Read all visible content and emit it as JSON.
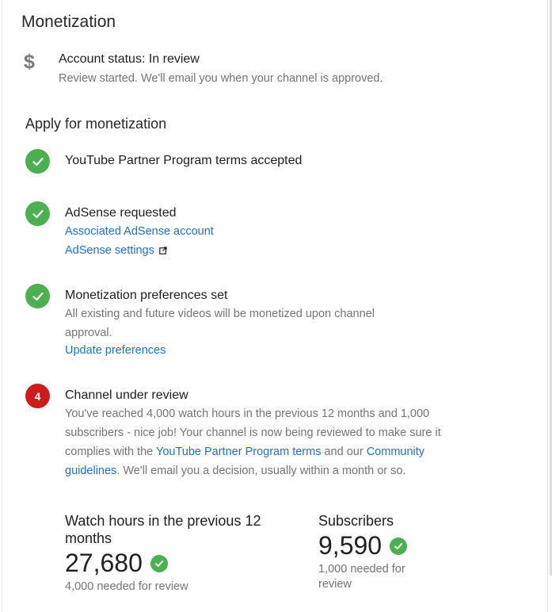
{
  "header": {
    "title": "Monetization"
  },
  "account_status": {
    "icon": "dollar-icon",
    "heading": "Account status: In review",
    "subtext": "Review started. We'll email you when your channel is approved."
  },
  "apply": {
    "heading": "Apply for monetization",
    "steps": [
      {
        "title": "YouTube Partner Program terms accepted"
      },
      {
        "title": "AdSense requested",
        "link1": "Associated AdSense account",
        "link2": "AdSense settings"
      },
      {
        "title": "Monetization preferences set",
        "desc": "All existing and future videos will be monetized upon channel approval.",
        "link": "Update preferences"
      },
      {
        "number": "4",
        "title": "Channel under review",
        "desc_part1": "You've reached 4,000 watch hours in the previous 12 months and 1,000 subscribers - nice job! Your channel is now being reviewed to make sure it complies with the ",
        "link_terms": "YouTube Partner Program terms",
        "desc_part2": " and our ",
        "link_guidelines": "Community guidelines",
        "desc_part3": ". We'll email you a decision, usually within a month or so."
      }
    ]
  },
  "stats": {
    "watch_hours": {
      "label": "Watch hours in the previous 12 months",
      "value": "27,680",
      "note": "4,000 needed for review"
    },
    "subscribers": {
      "label": "Subscribers",
      "value": "9,590",
      "note": "1,000 needed for review"
    }
  },
  "colors": {
    "success": "#4caf50",
    "alert": "#cc1c1c",
    "link": "#1f73c8"
  }
}
